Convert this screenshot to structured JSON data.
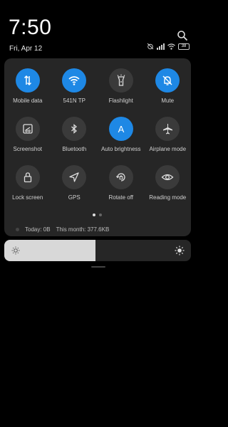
{
  "header": {
    "time": "7:50",
    "date": "Fri, Apr 12"
  },
  "status": {
    "battery": "38"
  },
  "tiles": [
    {
      "label": "Mobile data",
      "on": true,
      "icon": "arrows-updown-icon"
    },
    {
      "label": "541N     TP",
      "on": true,
      "icon": "wifi-icon"
    },
    {
      "label": "Flashlight",
      "on": false,
      "icon": "flashlight-icon"
    },
    {
      "label": "Mute",
      "on": true,
      "icon": "bell-mute-icon"
    },
    {
      "label": "Screenshot",
      "on": false,
      "icon": "screenshot-icon"
    },
    {
      "label": "Bluetooth",
      "on": false,
      "icon": "bluetooth-icon"
    },
    {
      "label": "Auto brightness",
      "on": true,
      "icon": "brightness-a-icon"
    },
    {
      "label": "Airplane mode",
      "on": false,
      "icon": "airplane-icon"
    },
    {
      "label": "Lock screen",
      "on": false,
      "icon": "lock-icon"
    },
    {
      "label": "GPS",
      "on": false,
      "icon": "gps-icon"
    },
    {
      "label": "Rotate off",
      "on": false,
      "icon": "rotate-lock-icon"
    },
    {
      "label": "Reading mode",
      "on": false,
      "icon": "eye-icon"
    }
  ],
  "usage": {
    "today": "Today: 0B",
    "month": "This month: 377.6KB"
  },
  "brightness": {
    "level": 0.49
  },
  "colors": {
    "accent": "#1e88e5",
    "panel": "#262626",
    "tile_off": "#3a3a3a"
  }
}
